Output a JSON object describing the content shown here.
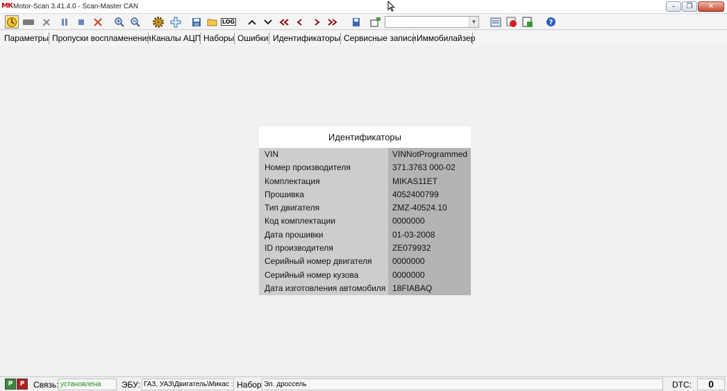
{
  "window": {
    "logo": "МК",
    "title": "Motor-Scan 3.41.4.0 - Scan-Master CAN",
    "minimize_glyph": "–",
    "maximize_glyph": "❐",
    "close_glyph": "✕"
  },
  "toolbar": {
    "buttons": [
      {
        "icon": "connect-icon",
        "active": true
      },
      {
        "icon": "adapter-icon"
      },
      {
        "icon": "tools-icon"
      },
      {
        "icon": "pause-icon"
      },
      {
        "icon": "stop-icon"
      },
      {
        "icon": "clear-icon"
      },
      {
        "icon": "zoom-in-icon"
      },
      {
        "icon": "zoom-out-icon"
      },
      {
        "icon": "settings-gear-icon"
      },
      {
        "icon": "add-icon"
      },
      {
        "icon": "save-icon"
      },
      {
        "icon": "open-folder-icon"
      },
      {
        "icon": "log-icon"
      },
      {
        "icon": "chevron-up-icon"
      },
      {
        "icon": "chevron-down-icon"
      },
      {
        "icon": "double-chevron-left-icon"
      },
      {
        "icon": "chevron-left-icon"
      },
      {
        "icon": "chevron-right-icon"
      },
      {
        "icon": "double-chevron-right-icon"
      },
      {
        "icon": "save-set-icon"
      },
      {
        "icon": "window-icon"
      },
      {
        "icon": "report-icon"
      },
      {
        "icon": "record-icon"
      },
      {
        "icon": "export-icon"
      },
      {
        "icon": "help-icon"
      }
    ],
    "log_text": "LOG",
    "combo_value": "",
    "combo_arrow": "▼"
  },
  "tabs": [
    "Параметры",
    "Пропуски воспламенения",
    "Каналы АЦП",
    "Наборы",
    "Ошибки",
    "Идентификаторы",
    "Сервисные записи",
    "Иммобилайзер"
  ],
  "panel": {
    "title": "Идентификаторы",
    "rows": [
      {
        "label": "VIN",
        "value": "VINNotProgrammed"
      },
      {
        "label": "Номер производителя",
        "value": "371.3763 000-02"
      },
      {
        "label": "Комплектация",
        "value": "MIKAS11ET"
      },
      {
        "label": "Прошивка",
        "value": "4052400799"
      },
      {
        "label": "Тип двигателя",
        "value": "ZMZ-40524.10"
      },
      {
        "label": "Код комплектации",
        "value": "0000000"
      },
      {
        "label": "Дата прошивки",
        "value": "01-03-2008"
      },
      {
        "label": "ID производителя",
        "value": "ZE079932"
      },
      {
        "label": "Серийный номер двигателя",
        "value": "0000000"
      },
      {
        "label": "Серийный номер кузова",
        "value": "0000000"
      },
      {
        "label": "Дата изготовления автомобиля",
        "value": "18FIABAQ"
      }
    ]
  },
  "status": {
    "icon1": "Р",
    "icon2": "Р",
    "link_label": "Связь:",
    "link_value": "установлена",
    "ecu_label": "ЭБУ:",
    "ecu_value": "ГАЗ, УАЗ\\Двигатель\\Микас :",
    "set_label": "Набор:",
    "set_value": "Эл. дроссель",
    "dtc_label": "DTC:",
    "dtc_value": "0"
  },
  "colors": {
    "label_cell": "#cdcdcd",
    "value_cell": "#b4b4b4",
    "link_ok": "#1a8a1a",
    "toolbar_active": "#ffe07a"
  }
}
